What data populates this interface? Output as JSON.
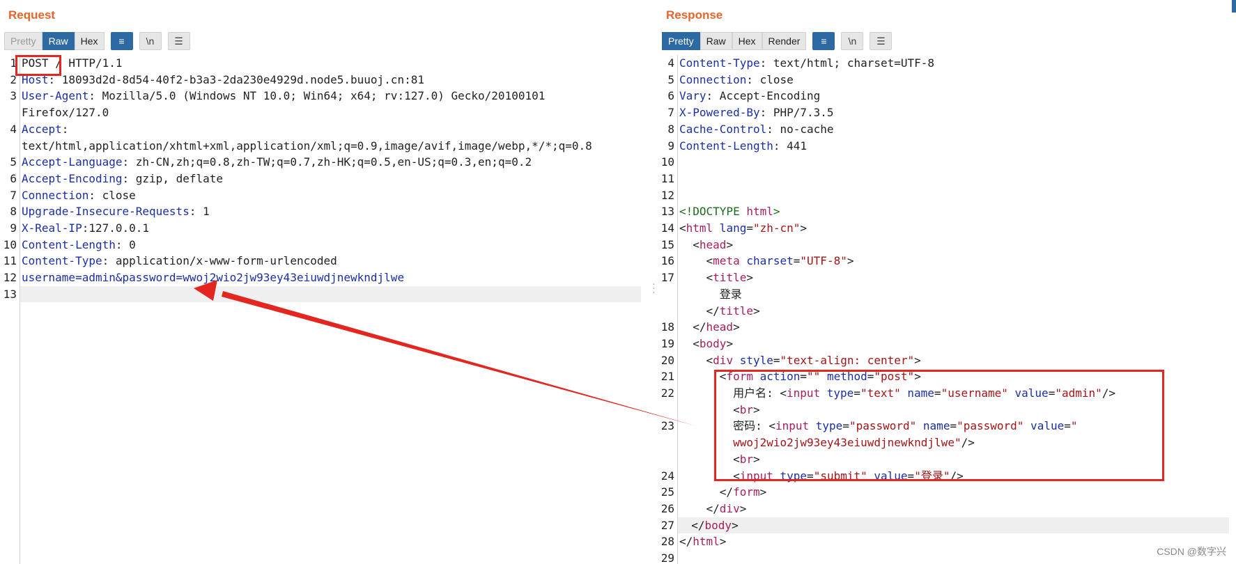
{
  "request": {
    "title": "Request",
    "tabs": [
      "Pretty",
      "Raw",
      "Hex"
    ],
    "active_tab": "Raw",
    "icons": [
      "wrap-icon",
      "newline-icon",
      "menu-icon"
    ],
    "newline_label": "\\n",
    "lines": [
      {
        "n": "1",
        "parts": [
          [
            "p",
            "POST / HTTP/1.1"
          ]
        ]
      },
      {
        "n": "2",
        "parts": [
          [
            "k",
            "Host"
          ],
          [
            "p",
            ": 18093d2d-8d54-40f2-b3a3-2da230e4929d.node5.buuoj.cn:81"
          ]
        ]
      },
      {
        "n": "3",
        "parts": [
          [
            "k",
            "User-Agent"
          ],
          [
            "p",
            ": Mozilla/5.0 (Windows NT 10.0; Win64; x64; rv:127.0) Gecko/20100101"
          ]
        ]
      },
      {
        "n": "",
        "parts": [
          [
            "p",
            "Firefox/127.0"
          ]
        ]
      },
      {
        "n": "4",
        "parts": [
          [
            "k",
            "Accept"
          ],
          [
            "p",
            ":"
          ]
        ]
      },
      {
        "n": "",
        "parts": [
          [
            "p",
            "text/html,application/xhtml+xml,application/xml;q=0.9,image/avif,image/webp,*/*;q=0.8"
          ]
        ]
      },
      {
        "n": "5",
        "parts": [
          [
            "k",
            "Accept-Language"
          ],
          [
            "p",
            ": zh-CN,zh;q=0.8,zh-TW;q=0.7,zh-HK;q=0.5,en-US;q=0.3,en;q=0.2"
          ]
        ]
      },
      {
        "n": "6",
        "parts": [
          [
            "k",
            "Accept-Encoding"
          ],
          [
            "p",
            ": gzip, deflate"
          ]
        ]
      },
      {
        "n": "7",
        "parts": [
          [
            "k",
            "Connection"
          ],
          [
            "p",
            ": close"
          ]
        ]
      },
      {
        "n": "8",
        "parts": [
          [
            "k",
            "Upgrade-Insecure-Requests"
          ],
          [
            "p",
            ": 1"
          ]
        ]
      },
      {
        "n": "9",
        "parts": [
          [
            "k",
            "X-Real-IP"
          ],
          [
            "p",
            ":127.0.0.1"
          ]
        ]
      },
      {
        "n": "10",
        "parts": [
          [
            "k",
            "Content-Length"
          ],
          [
            "p",
            ": 0"
          ]
        ]
      },
      {
        "n": "11",
        "parts": [
          [
            "k",
            "Content-Type"
          ],
          [
            "p",
            ": application/x-www-form-urlencoded"
          ]
        ]
      },
      {
        "n": "12",
        "parts": [
          [
            "k",
            "username=admin&password=wwoj2wio2jw93ey43eiuwdjnewkndjlwe"
          ]
        ]
      },
      {
        "n": "13",
        "parts": [
          [
            "p",
            ""
          ]
        ],
        "highlight": true
      }
    ]
  },
  "response": {
    "title": "Response",
    "tabs": [
      "Pretty",
      "Raw",
      "Hex",
      "Render"
    ],
    "active_tab": "Pretty",
    "icons": [
      "wrap-icon",
      "newline-icon",
      "menu-icon"
    ],
    "newline_label": "\\n",
    "lines": [
      {
        "n": "4",
        "parts": [
          [
            "k",
            "Content-Type"
          ],
          [
            "p",
            ": text/html; charset=UTF-8"
          ]
        ]
      },
      {
        "n": "5",
        "parts": [
          [
            "k",
            "Connection"
          ],
          [
            "p",
            ": close"
          ]
        ]
      },
      {
        "n": "6",
        "parts": [
          [
            "k",
            "Vary"
          ],
          [
            "p",
            ": Accept-Encoding"
          ]
        ]
      },
      {
        "n": "7",
        "parts": [
          [
            "k",
            "X-Powered-By"
          ],
          [
            "p",
            ": PHP/7.3.5"
          ]
        ]
      },
      {
        "n": "8",
        "parts": [
          [
            "k",
            "Cache-Control"
          ],
          [
            "p",
            ": no-cache"
          ]
        ]
      },
      {
        "n": "9",
        "parts": [
          [
            "k",
            "Content-Length"
          ],
          [
            "p",
            ": 441"
          ]
        ]
      },
      {
        "n": "10",
        "parts": [
          [
            "p",
            ""
          ]
        ]
      },
      {
        "n": "11",
        "parts": [
          [
            "p",
            ""
          ]
        ]
      },
      {
        "n": "12",
        "parts": [
          [
            "p",
            ""
          ]
        ]
      },
      {
        "n": "13",
        "parts": [
          [
            "doct",
            "<!DOCTYPE "
          ],
          [
            "tag",
            "html"
          ],
          [
            "doct",
            ">"
          ]
        ]
      },
      {
        "n": "14",
        "parts": [
          [
            "p",
            "<"
          ],
          [
            "tag",
            "html"
          ],
          [
            "attr",
            " lang"
          ],
          [
            "p",
            "="
          ],
          [
            "val",
            "\"zh-cn\""
          ],
          [
            "p",
            ">"
          ]
        ]
      },
      {
        "n": "15",
        "parts": [
          [
            "p",
            "  <"
          ],
          [
            "tag",
            "head"
          ],
          [
            "p",
            ">"
          ]
        ]
      },
      {
        "n": "16",
        "parts": [
          [
            "p",
            "    <"
          ],
          [
            "tag",
            "meta"
          ],
          [
            "attr",
            " charset"
          ],
          [
            "p",
            "="
          ],
          [
            "val",
            "\"UTF-8\""
          ],
          [
            "p",
            ">"
          ]
        ]
      },
      {
        "n": "17",
        "parts": [
          [
            "p",
            "    <"
          ],
          [
            "tag",
            "title"
          ],
          [
            "p",
            ">"
          ]
        ]
      },
      {
        "n": "",
        "parts": [
          [
            "p",
            "      登录"
          ]
        ]
      },
      {
        "n": "",
        "parts": [
          [
            "p",
            "    </"
          ],
          [
            "tag",
            "title"
          ],
          [
            "p",
            ">"
          ]
        ]
      },
      {
        "n": "18",
        "parts": [
          [
            "p",
            "  </"
          ],
          [
            "tag",
            "head"
          ],
          [
            "p",
            ">"
          ]
        ]
      },
      {
        "n": "19",
        "parts": [
          [
            "p",
            "  <"
          ],
          [
            "tag",
            "body"
          ],
          [
            "p",
            ">"
          ]
        ]
      },
      {
        "n": "20",
        "parts": [
          [
            "p",
            "    <"
          ],
          [
            "tag",
            "div"
          ],
          [
            "attr",
            " style"
          ],
          [
            "p",
            "="
          ],
          [
            "val",
            "\"text-align: center\""
          ],
          [
            "p",
            ">"
          ]
        ]
      },
      {
        "n": "21",
        "parts": [
          [
            "p",
            "      <"
          ],
          [
            "tag",
            "form"
          ],
          [
            "attr",
            " action"
          ],
          [
            "p",
            "="
          ],
          [
            "val",
            "\"\""
          ],
          [
            "attr",
            " method"
          ],
          [
            "p",
            "="
          ],
          [
            "val",
            "\"post\""
          ],
          [
            "p",
            ">"
          ]
        ]
      },
      {
        "n": "22",
        "parts": [
          [
            "p",
            "        用户名: <"
          ],
          [
            "tag",
            "input"
          ],
          [
            "attr",
            " type"
          ],
          [
            "p",
            "="
          ],
          [
            "val",
            "\"text\""
          ],
          [
            "attr",
            " name"
          ],
          [
            "p",
            "="
          ],
          [
            "val",
            "\"username\""
          ],
          [
            "attr",
            " value"
          ],
          [
            "p",
            "="
          ],
          [
            "val",
            "\"admin\""
          ],
          [
            "p",
            "/>"
          ]
        ]
      },
      {
        "n": "",
        "parts": [
          [
            "p",
            "        <"
          ],
          [
            "tag",
            "br"
          ],
          [
            "p",
            ">"
          ]
        ]
      },
      {
        "n": "23",
        "parts": [
          [
            "p",
            "        密码: <"
          ],
          [
            "tag",
            "input"
          ],
          [
            "attr",
            " type"
          ],
          [
            "p",
            "="
          ],
          [
            "val",
            "\"password\""
          ],
          [
            "attr",
            " name"
          ],
          [
            "p",
            "="
          ],
          [
            "val",
            "\"password\""
          ],
          [
            "attr",
            " value"
          ],
          [
            "p",
            "="
          ],
          [
            "val",
            "\""
          ]
        ]
      },
      {
        "n": "",
        "parts": [
          [
            "val",
            "        wwoj2wio2jw93ey43eiuwdjnewkndjlwe\""
          ],
          [
            "p",
            "/>"
          ]
        ]
      },
      {
        "n": "",
        "parts": [
          [
            "p",
            "        <"
          ],
          [
            "tag",
            "br"
          ],
          [
            "p",
            ">"
          ]
        ]
      },
      {
        "n": "24",
        "parts": [
          [
            "p",
            "        <"
          ],
          [
            "tag",
            "input"
          ],
          [
            "attr",
            " type"
          ],
          [
            "p",
            "="
          ],
          [
            "val",
            "\"submit\""
          ],
          [
            "attr",
            " value"
          ],
          [
            "p",
            "="
          ],
          [
            "val",
            "\"登录\""
          ],
          [
            "p",
            "/>"
          ]
        ]
      },
      {
        "n": "25",
        "parts": [
          [
            "p",
            "      </"
          ],
          [
            "tag",
            "form"
          ],
          [
            "p",
            ">"
          ]
        ]
      },
      {
        "n": "26",
        "parts": [
          [
            "p",
            "    </"
          ],
          [
            "tag",
            "div"
          ],
          [
            "p",
            ">"
          ]
        ]
      },
      {
        "n": "27",
        "parts": [
          [
            "p",
            "  </"
          ],
          [
            "tag",
            "body"
          ],
          [
            "p",
            ">"
          ]
        ],
        "highlight": true
      },
      {
        "n": "28",
        "parts": [
          [
            "p",
            "</"
          ],
          [
            "tag",
            "html"
          ],
          [
            "p",
            ">"
          ]
        ]
      },
      {
        "n": "29",
        "parts": [
          [
            "p",
            ""
          ]
        ]
      }
    ]
  },
  "watermark": "CSDN @数字兴",
  "colors": {
    "title": "#e8652a",
    "active_tab": "#2d6aa3",
    "annotation": "#e3261f"
  }
}
